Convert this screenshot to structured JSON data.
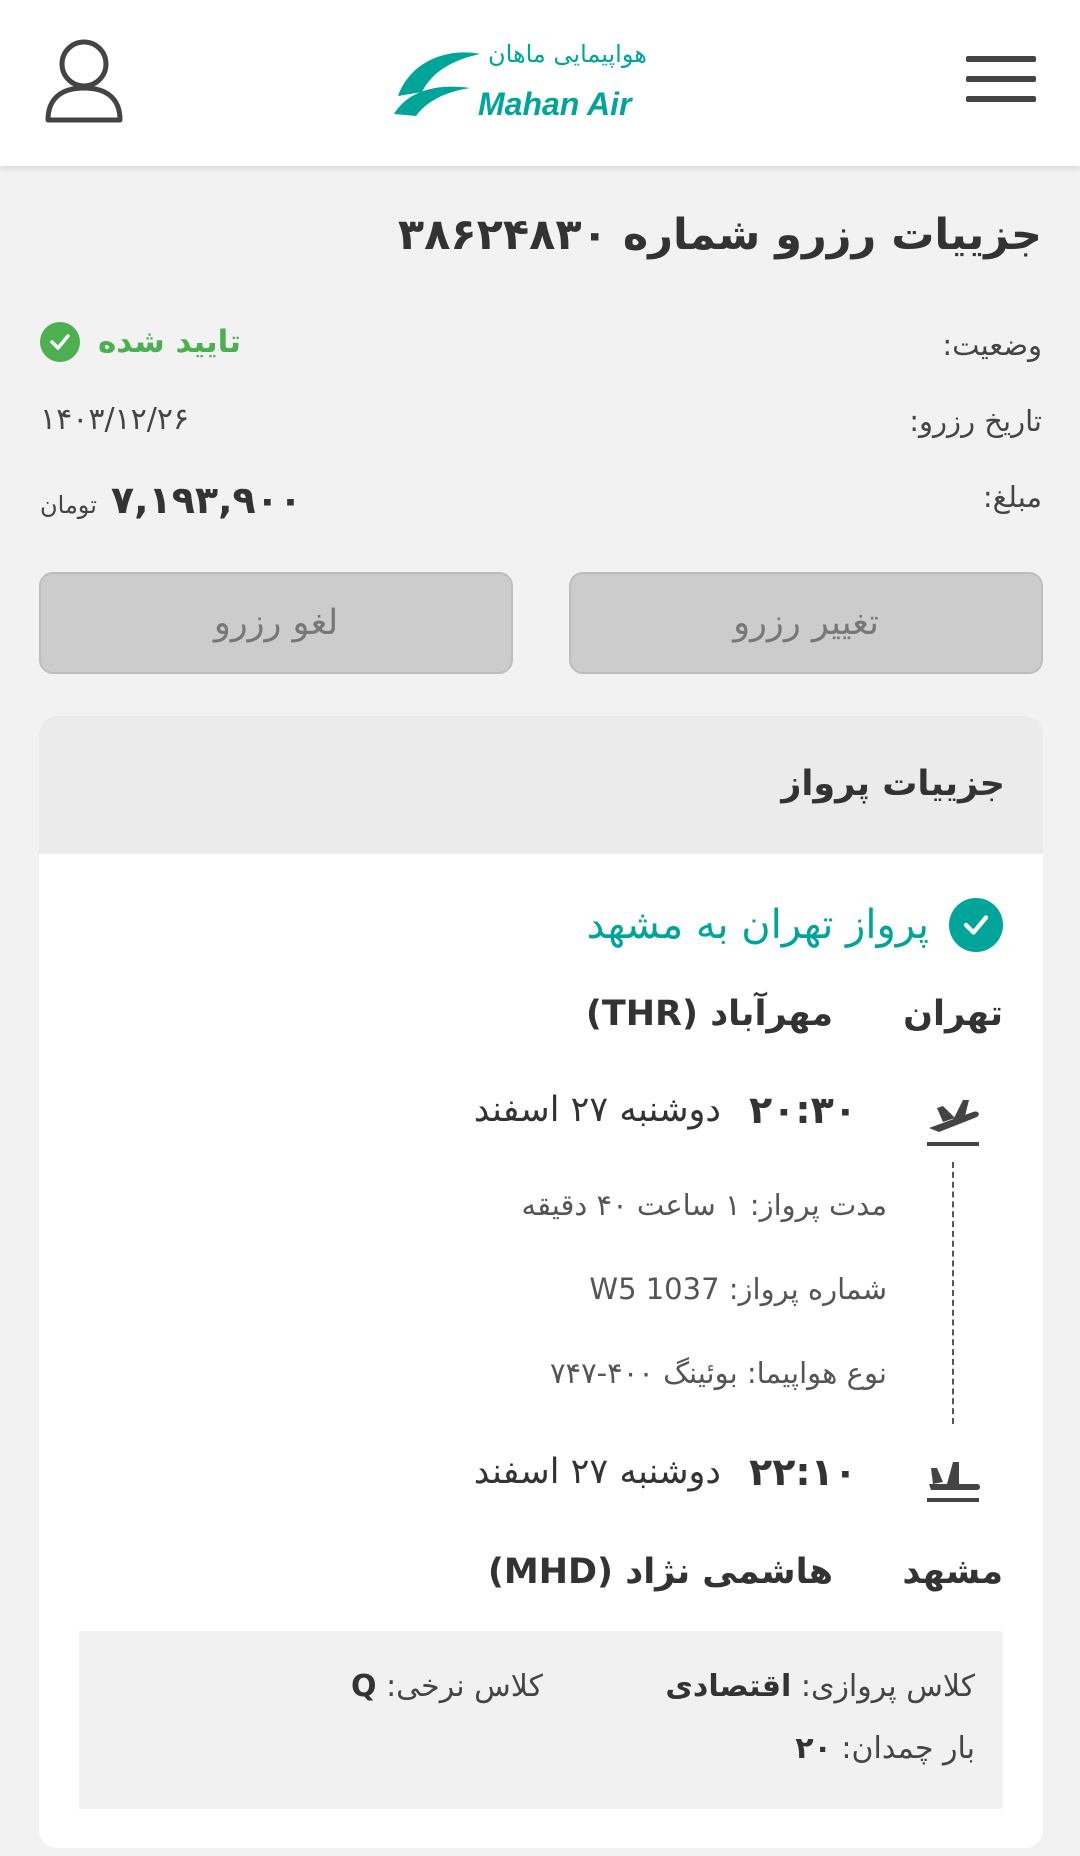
{
  "header": {
    "logo_en": "Mahan Air",
    "logo_fa": "هواپیمایی ماهان",
    "brand_color": "#00a59a",
    "menu_icon": "hamburger-icon",
    "user_icon": "user-icon"
  },
  "booking": {
    "title": "جزییات رزرو شماره ۳۸۶۲۴۸۳۰",
    "status_label": "وضعیت:",
    "status_value": "تایید شده",
    "status_color": "#4caf50",
    "date_label": "تاریخ رزرو:",
    "date_value": "۱۴۰۳/۱۲/۲۶",
    "amount_label": "مبلغ:",
    "amount_value": "۷,۱۹۳,۹۰۰",
    "amount_unit": "تومان"
  },
  "actions": {
    "change_label": "تغییر رزرو",
    "cancel_label": "لغو رزرو"
  },
  "flight": {
    "section_title": "جزییات پرواز",
    "route_title": "پرواز تهران به مشهد",
    "origin_city": "تهران",
    "origin_airport": "مهرآباد (THR)",
    "departure_time": "۲۰:۳۰",
    "departure_date": "دوشنبه ۲۷ اسفند",
    "duration": "مدت پرواز: ۱ ساعت ۴۰ دقیقه",
    "flight_number_label": "شماره پرواز:",
    "flight_number": "W5 1037",
    "aircraft": "نوع هواپیما: بوئینگ ۴۰۰-۷۴۷",
    "arrival_time": "۲۲:۱۰",
    "arrival_date": "دوشنبه ۲۷ اسفند",
    "dest_city": "مشهد",
    "dest_airport": "هاشمی نژاد (MHD)",
    "cabin_label": "کلاس پروازی:",
    "cabin_value": "اقتصادی",
    "fare_class_label": "کلاس نرخی:",
    "fare_class_value": "Q",
    "baggage_label": "بار چمدان:",
    "baggage_value": "۲۰"
  }
}
